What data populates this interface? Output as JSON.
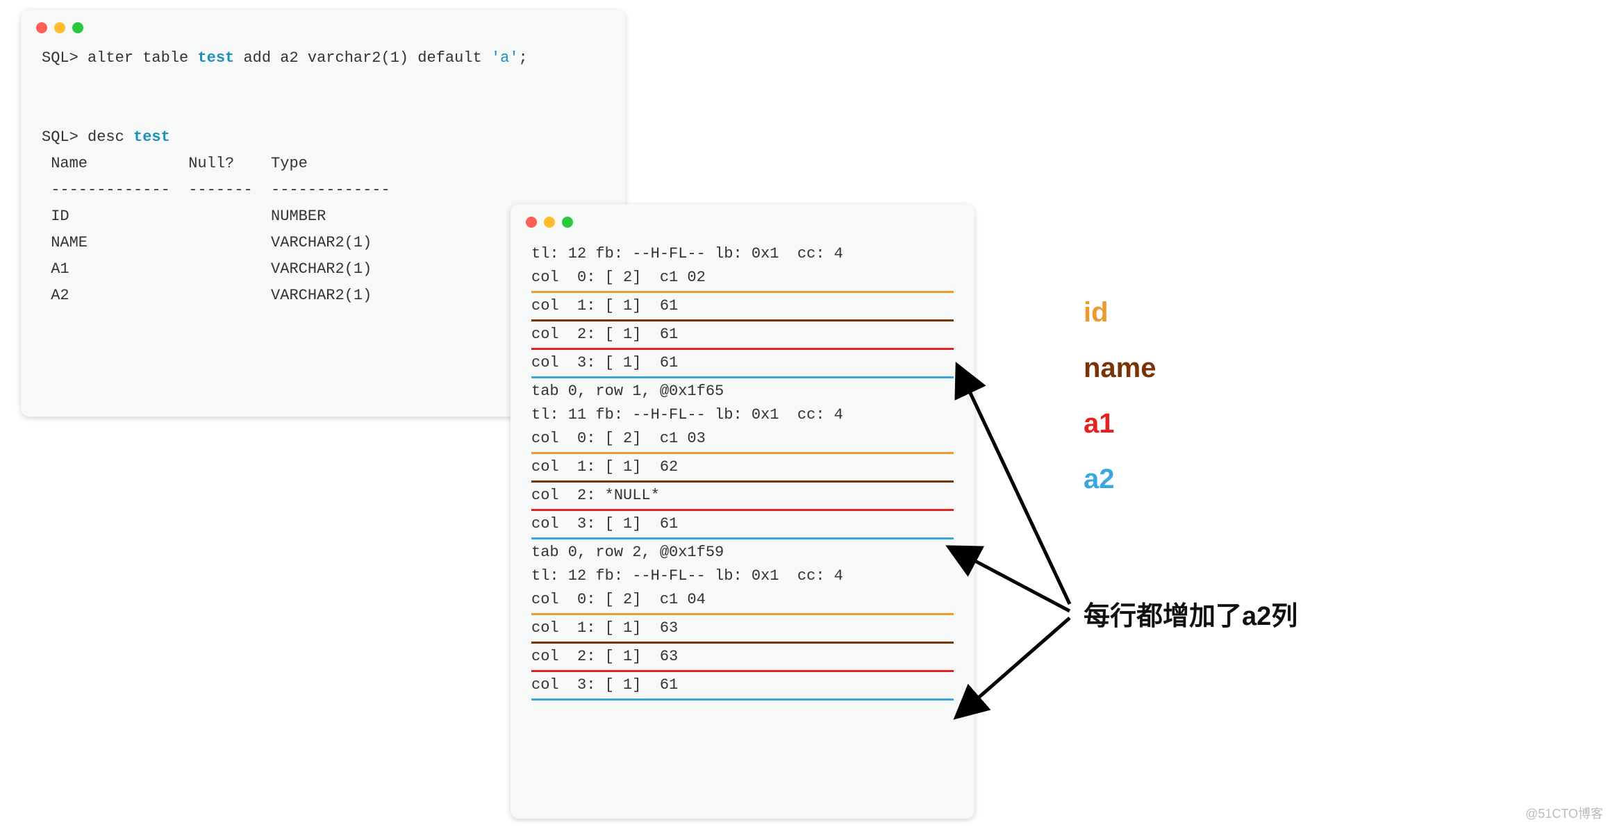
{
  "win1": {
    "sql_prompt": "SQL>",
    "alter_stmt_pre": " alter table ",
    "test_token": "test",
    "alter_stmt_mid": " add a2 varchar2(1) default ",
    "str_literal": "'a'",
    "stmt_end": ";",
    "desc_stmt_pre": " desc ",
    "desc_columns_header": " Name           Null?    Type",
    "desc_divider": " -------------  -------  -------------",
    "rows": [
      {
        "name": "ID",
        "null": "",
        "type": "NUMBER"
      },
      {
        "name": "NAME",
        "null": "",
        "type": "VARCHAR2(1)"
      },
      {
        "name": "A1",
        "null": "",
        "type": "VARCHAR2(1)"
      },
      {
        "name": "A2",
        "null": "",
        "type": "VARCHAR2(1)"
      }
    ]
  },
  "win2": {
    "lines": [
      {
        "text": "tl: 12 fb: --H-FL-- lb: 0x1  cc: 4"
      },
      {
        "text": "col  0: [ 2]  c1 02",
        "after": "orange"
      },
      {
        "text": "col  1: [ 1]  61",
        "after": "brown"
      },
      {
        "text": "col  2: [ 1]  61",
        "after": "red"
      },
      {
        "text": "col  3: [ 1]  61",
        "after": "blue"
      },
      {
        "text": "tab 0, row 1, @0x1f65"
      },
      {
        "text": "tl: 11 fb: --H-FL-- lb: 0x1  cc: 4"
      },
      {
        "text": "col  0: [ 2]  c1 03",
        "after": "orange"
      },
      {
        "text": "col  1: [ 1]  62",
        "after": "brown"
      },
      {
        "text": "col  2: *NULL*",
        "after": "red"
      },
      {
        "text": "col  3: [ 1]  61",
        "after": "blue"
      },
      {
        "text": "tab 0, row 2, @0x1f59"
      },
      {
        "text": "tl: 12 fb: --H-FL-- lb: 0x1  cc: 4"
      },
      {
        "text": "col  0: [ 2]  c1 04",
        "after": "orange"
      },
      {
        "text": "col  1: [ 1]  63",
        "after": "brown"
      },
      {
        "text": "col  2: [ 1]  63",
        "after": "red"
      },
      {
        "text": "col  3: [ 1]  61",
        "after": "blue"
      }
    ]
  },
  "labels": {
    "id": "id",
    "name": "name",
    "a1": "a1",
    "a2": "a2"
  },
  "caption": "每行都增加了a2列",
  "watermark": "@51CTO博客"
}
